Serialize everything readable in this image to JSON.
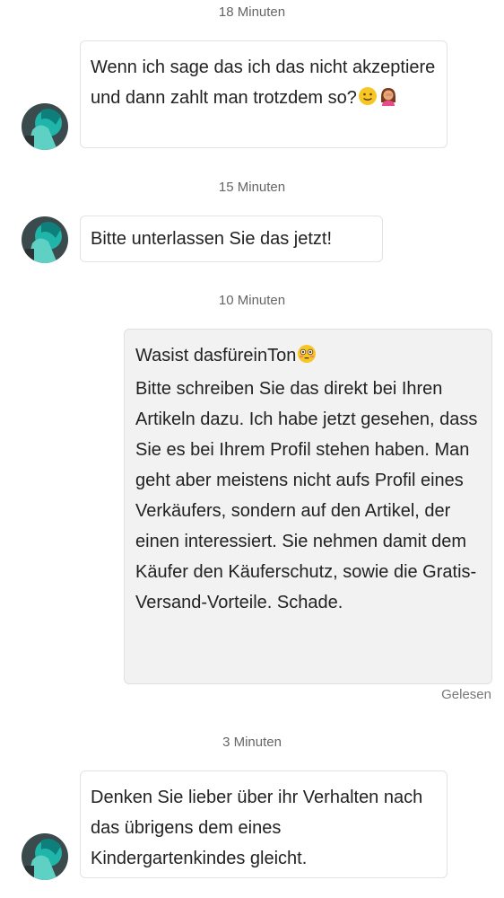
{
  "messages": [
    {
      "timestamp": "18 Minuten",
      "direction": "incoming",
      "text": "Wenn ich sage das ich das nicht akzeptiere und dann zahlt man trotzdem so?",
      "emojis": [
        "slightly-smiling-face",
        "woman-facepalming"
      ]
    },
    {
      "timestamp": "15 Minuten",
      "direction": "incoming",
      "text": "Bitte unterlassen Sie das jetzt!"
    },
    {
      "timestamp": "10 Minuten",
      "direction": "outgoing",
      "first_line": "Wasist dasfüreinTon",
      "first_line_emoji": "flushed-face",
      "text": "Bitte schreiben Sie das direkt bei Ihren Artikeln dazu. Ich habe jetzt gesehen, dass Sie es bei Ihrem Profil stehen haben. Man geht aber meistens nicht aufs Profil eines Verkäufers, sondern auf den Artikel, der einen interessiert. Sie nehmen damit dem Käufer den Käuferschutz, sowie die Gratis-Versand-Vorteile. Schade.",
      "status": "Gelesen"
    },
    {
      "timestamp": "3 Minuten",
      "direction": "incoming",
      "text": "Denken Sie lieber über ihr Verhalten nach das übrigens dem eines Kindergartenkindes gleicht."
    }
  ],
  "avatar_icon": "user-avatar-teal-figure",
  "colors": {
    "background": "#ffffff",
    "incoming_bubble": "#ffffff",
    "outgoing_bubble": "#f2f2f2",
    "border": "#e3e3e3",
    "timestamp_text": "#666666",
    "message_text": "#222222"
  }
}
